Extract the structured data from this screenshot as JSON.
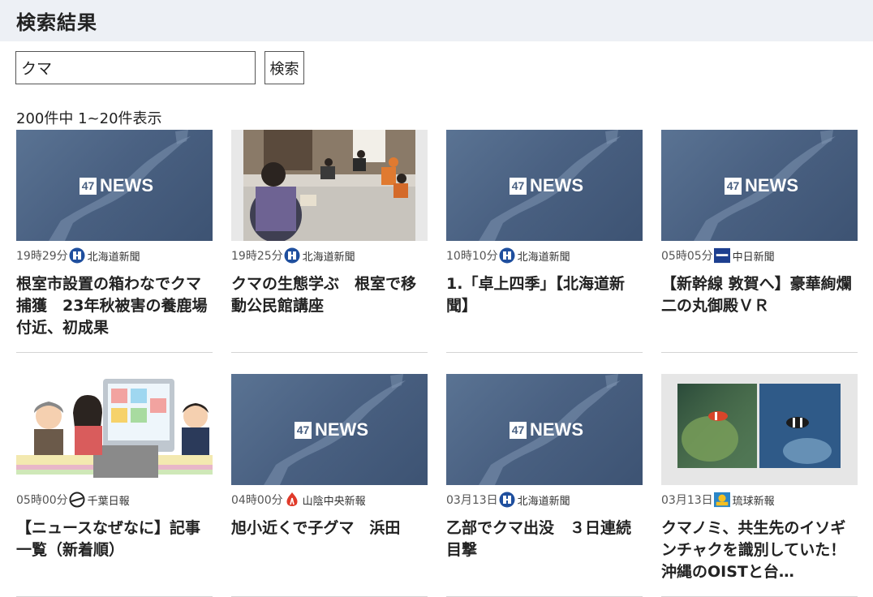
{
  "page": {
    "heading": "検索結果"
  },
  "search": {
    "value": "クマ",
    "button_label": "検索"
  },
  "result_count": "200件中 1~20件表示",
  "colors": {
    "header_bg": "#edf0f5",
    "news_thumb": "#4a6182"
  },
  "results": [
    {
      "thumb": "47news",
      "time": "19時29分",
      "source": "北海道新聞",
      "source_icon": "hokkaido-shimbun-icon",
      "title": "根室市設置の箱わなでクマ捕獲　23年秋被害の養鹿場付近、初成果"
    },
    {
      "thumb": "photo-meeting",
      "time": "19時25分",
      "source": "北海道新聞",
      "source_icon": "hokkaido-shimbun-icon",
      "title": "クマの生態学ぶ　根室で移動公民館講座"
    },
    {
      "thumb": "47news",
      "time": "10時10分",
      "source": "北海道新聞",
      "source_icon": "hokkaido-shimbun-icon",
      "title": "1.「卓上四季」【北海道新聞】"
    },
    {
      "thumb": "47news",
      "time": "05時05分",
      "source": "中日新聞",
      "source_icon": "chunichi-shimbun-icon",
      "title": "【新幹線 敦賀へ】豪華絢爛 二の丸御殿ＶＲ"
    },
    {
      "thumb": "illustration-newscasters",
      "time": "05時00分",
      "source": "千葉日報",
      "source_icon": "chiba-nippo-icon",
      "title": "【ニュースなぜなに】記事一覧（新着順）"
    },
    {
      "thumb": "47news",
      "time": "04時00分",
      "source": "山陰中央新報",
      "source_icon": "sanin-chuo-shimpo-icon",
      "title": "旭小近くで子グマ　浜田"
    },
    {
      "thumb": "47news",
      "time": "03月13日",
      "source": "北海道新聞",
      "source_icon": "hokkaido-shimbun-icon",
      "title": "乙部でクマ出没　３日連続目撃"
    },
    {
      "thumb": "photo-clownfish",
      "time": "03月13日",
      "source": "琉球新報",
      "source_icon": "ryukyu-shimpo-icon",
      "title": "クマノミ、共生先のイソギンチャクを識別していた！　沖縄のOISTと台…"
    }
  ]
}
